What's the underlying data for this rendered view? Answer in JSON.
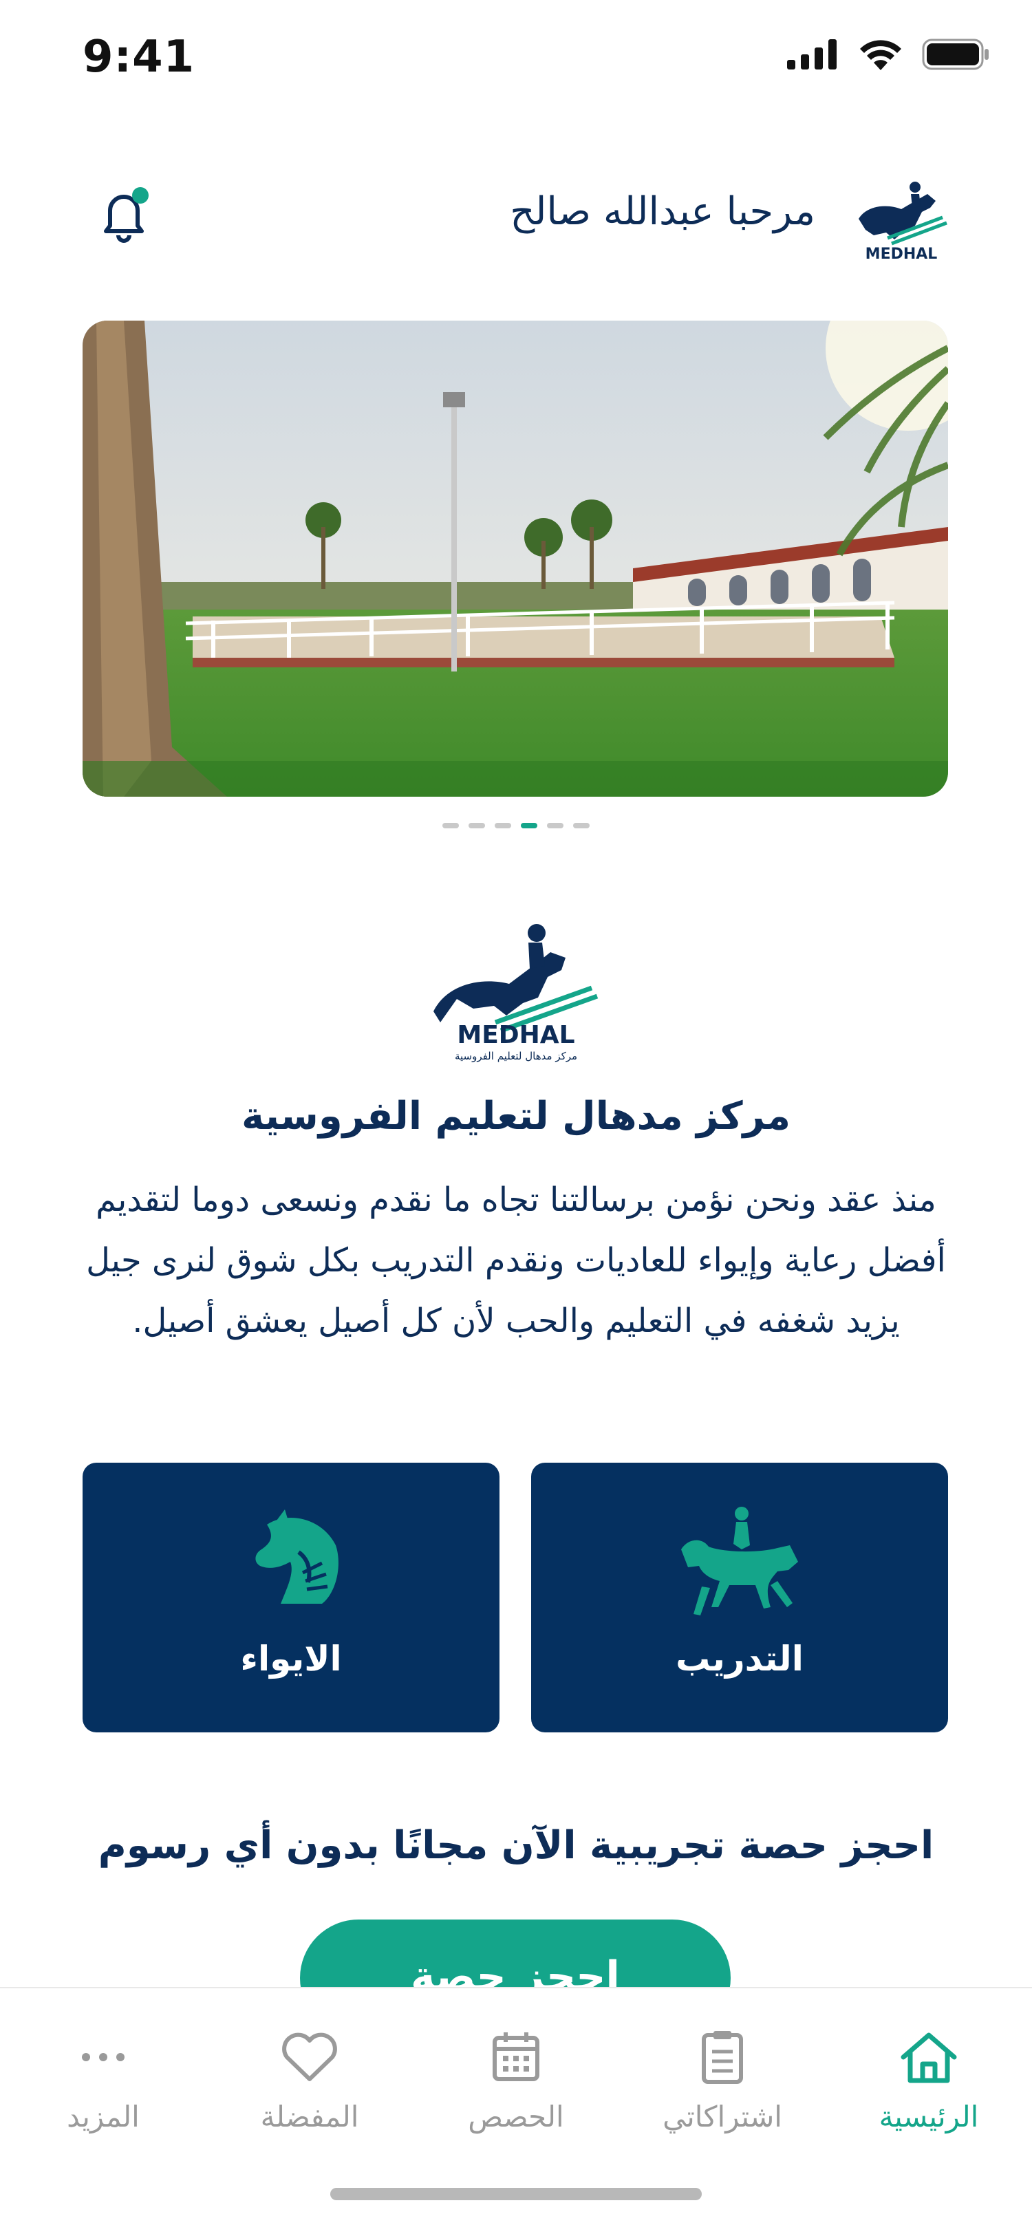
{
  "status_bar": {
    "time": "9:41"
  },
  "header": {
    "greeting": "مرحبا عبدالله صالح",
    "logo_icon": "medhal-logo-icon",
    "notification_icon": "bell-icon"
  },
  "carousel": {
    "slide_count": 6,
    "active_index": 3
  },
  "about": {
    "logo_text": "MEDHAL",
    "logo_subtext": "مركز مدهال لتعليم الفروسية",
    "title": "مركز مدهال لتعليم الفروسية",
    "description": "منذ عقد ونحن نؤمن برسالتنا تجاه ما نقدم ونسعى دوما لتقديم أفضل رعاية وإيواء للعاديات ونقدم التدريب بكل شوق لنرى جيل يزيد شغفه في التعليم والحب لأن كل أصيل يعشق أصيل."
  },
  "services": [
    {
      "label": "الايواء",
      "icon": "horse-head-hand-icon"
    },
    {
      "label": "التدريب",
      "icon": "horse-rider-icon"
    }
  ],
  "promo": {
    "text": "احجز حصة تجريبية الآن مجانًا بدون أي رسوم"
  },
  "cta": {
    "label": "احجز حصة"
  },
  "tabs": [
    {
      "label": "المزيد",
      "icon": "more-dots-icon"
    },
    {
      "label": "المفضلة",
      "icon": "heart-icon"
    },
    {
      "label": "الحصص",
      "icon": "calendar-icon"
    },
    {
      "label": "اشتراكاتي",
      "icon": "clipboard-icon"
    },
    {
      "label": "الرئيسية",
      "icon": "home-icon",
      "active": true
    }
  ],
  "colors": {
    "primary_navy": "#053060",
    "accent_green": "#14a58a",
    "text_navy": "#0d2c57",
    "tab_inactive": "#9a9a9a"
  }
}
